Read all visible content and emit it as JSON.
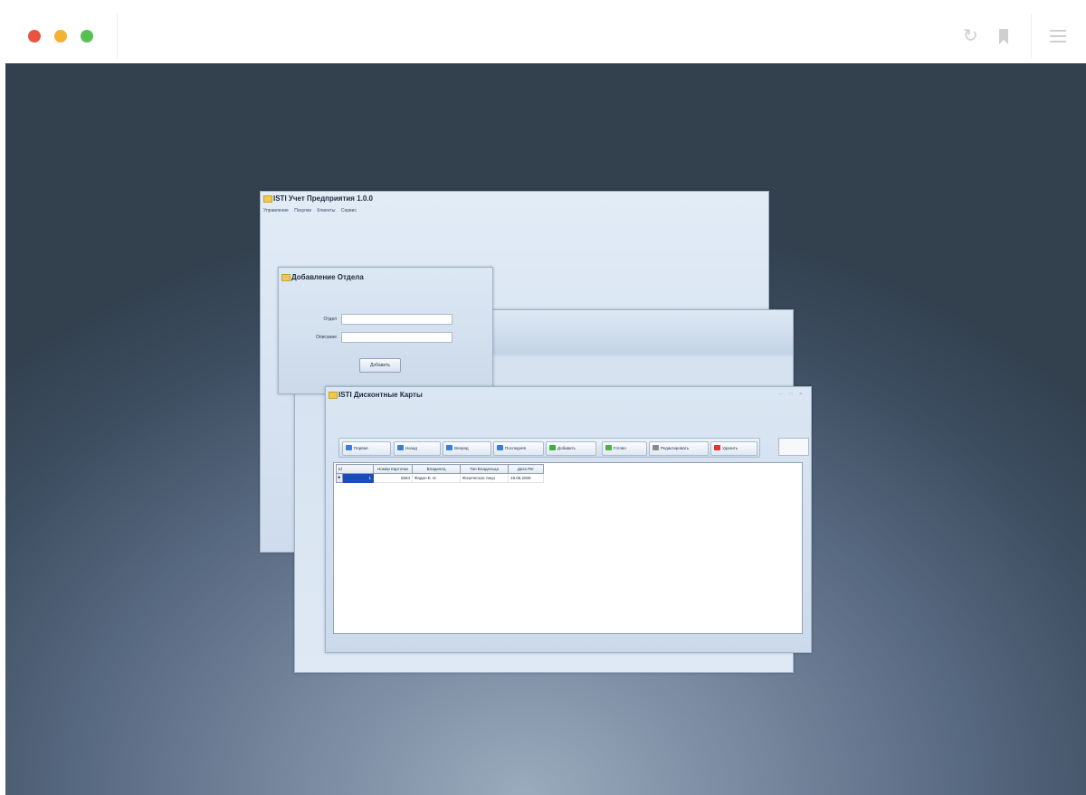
{
  "app": {
    "title": "ISTI Учет Предприятия 1.0.0",
    "menu": [
      "Управление",
      "Покупки",
      "Клиенты",
      "Сервис"
    ]
  },
  "dialog": {
    "title": "Добавление Отдела",
    "fields": [
      {
        "label": "Отдел",
        "value": ""
      },
      {
        "label": "Описание",
        "value": ""
      }
    ],
    "add_button": "Добавить"
  },
  "cards_window": {
    "title": "ISTI Дисконтные Карты",
    "toolbar": [
      {
        "label": "Первая",
        "icon": "first-icon",
        "color": "#3a7fd5"
      },
      {
        "label": "Назад",
        "icon": "back-arrow-icon",
        "color": "#3a7fd5"
      },
      {
        "label": "Вперед",
        "icon": "forward-arrow-icon",
        "color": "#3a7fd5"
      },
      {
        "label": "Последняя",
        "icon": "last-icon",
        "color": "#3a7fd5"
      },
      {
        "label": "Добавить",
        "icon": "plus-icon",
        "color": "#3fae3a"
      },
      {
        "label": "Готово",
        "icon": "check-icon",
        "color": "#4bb33f"
      },
      {
        "label": "Редактировать",
        "icon": "pencil-icon",
        "color": "#8a8a8a"
      },
      {
        "label": "Удалить",
        "icon": "delete-icon",
        "color": "#d63a2e"
      }
    ],
    "grid": {
      "columns": [
        "Id",
        "Номер Карточки",
        "Владелец",
        "Тип Владельца",
        "Дата Рег"
      ],
      "rows": [
        [
          "1",
          "5684",
          "Фадин Е. И.",
          "Физическое лицо",
          "19.06.2009"
        ]
      ]
    }
  }
}
